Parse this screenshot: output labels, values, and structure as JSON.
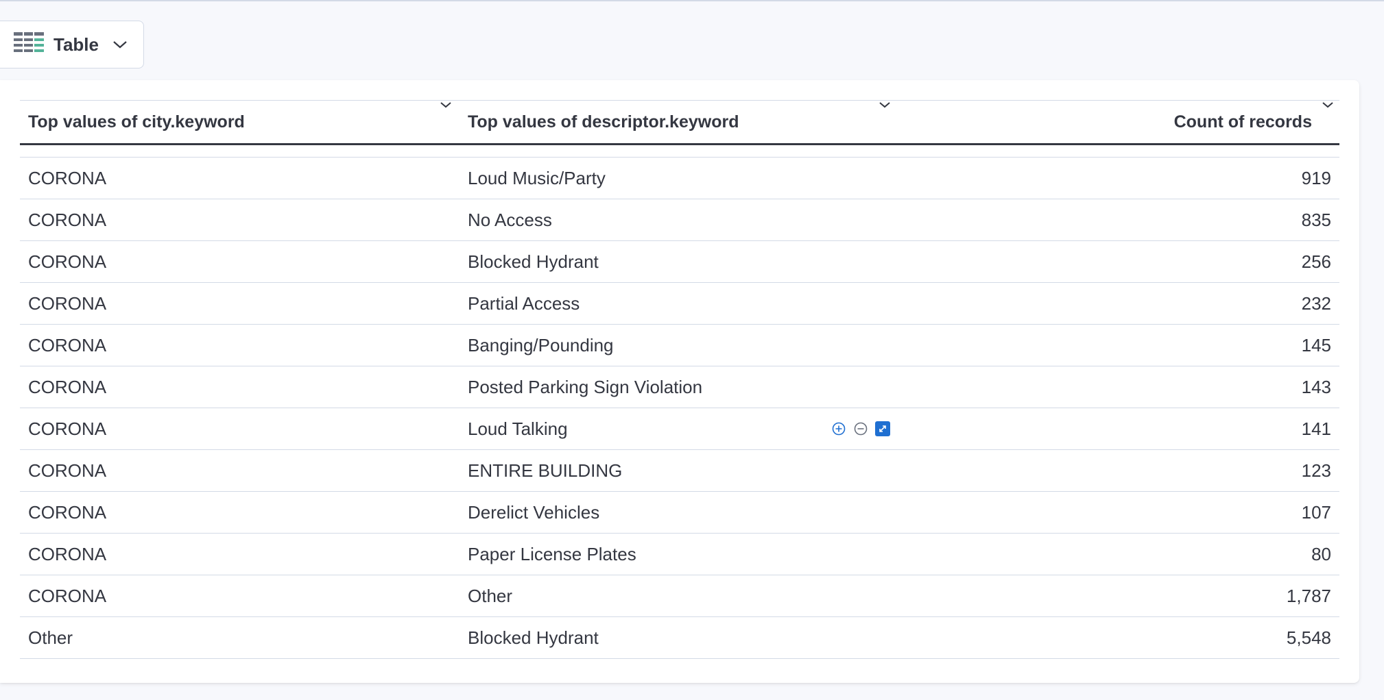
{
  "toolbar": {
    "chart_type_label": "Table",
    "chart_type_icon": "table-grid-icon"
  },
  "colors": {
    "accent": "#1f6fd1",
    "text": "#343741",
    "border": "#d3dae6",
    "icon_teal": "#54b399"
  },
  "table": {
    "columns": [
      "Top values of city.keyword",
      "Top values of descriptor.keyword",
      "Count of records"
    ],
    "rows": [
      {
        "city": "CORONA",
        "descriptor": "Loud Music/Party",
        "count": "919"
      },
      {
        "city": "CORONA",
        "descriptor": "No Access",
        "count": "835"
      },
      {
        "city": "CORONA",
        "descriptor": "Blocked Hydrant",
        "count": "256"
      },
      {
        "city": "CORONA",
        "descriptor": "Partial Access",
        "count": "232"
      },
      {
        "city": "CORONA",
        "descriptor": "Banging/Pounding",
        "count": "145"
      },
      {
        "city": "CORONA",
        "descriptor": "Posted Parking Sign Violation",
        "count": "143"
      },
      {
        "city": "CORONA",
        "descriptor": "Loud Talking",
        "count": "141"
      },
      {
        "city": "CORONA",
        "descriptor": "ENTIRE BUILDING",
        "count": "123"
      },
      {
        "city": "CORONA",
        "descriptor": "Derelict Vehicles",
        "count": "107"
      },
      {
        "city": "CORONA",
        "descriptor": "Paper License Plates",
        "count": "80"
      },
      {
        "city": "CORONA",
        "descriptor": "Other",
        "count": "1,787"
      },
      {
        "city": "Other",
        "descriptor": "Blocked Hydrant",
        "count": "5,548"
      }
    ],
    "hover_actions_row": 6,
    "hover_actions": [
      "filter-for-icon",
      "filter-out-icon",
      "expand-cell-icon"
    ]
  }
}
